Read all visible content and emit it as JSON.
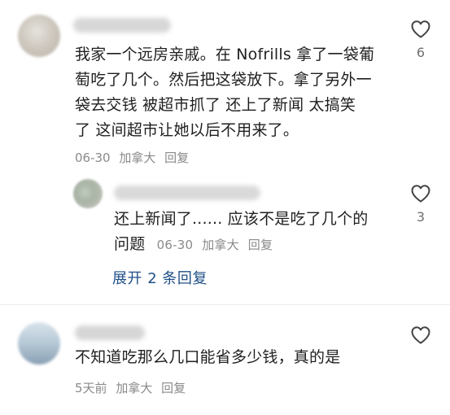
{
  "comments": [
    {
      "text_lines": [
        "我家一个远房亲戚。在 Nofrills 拿了一袋葡",
        "萄吃了几个。然后把这袋放下。拿了另外一",
        "袋去交钱  被超市抓了  还上了新闻  太搞笑",
        "了  这间超市让她以后不用来了。"
      ],
      "date": "06-30",
      "location": "加拿大",
      "reply_label": "回复",
      "likes": "6"
    },
    {
      "text_line1": "还上新闻了...... 应该不是吃了几个的",
      "text_line2": "问题",
      "date": "06-30",
      "location": "加拿大",
      "reply_label": "回复",
      "likes": "3"
    },
    {
      "text": "不知道吃那么几口能省多少钱，真的是",
      "date": "5天前",
      "location": "加拿大",
      "reply_label": "回复",
      "likes": ""
    }
  ],
  "expand_replies": "展开 2 条回复",
  "colors": {
    "link": "#1f4f86",
    "meta": "#8a8a8a",
    "text": "#1f1f1f"
  }
}
